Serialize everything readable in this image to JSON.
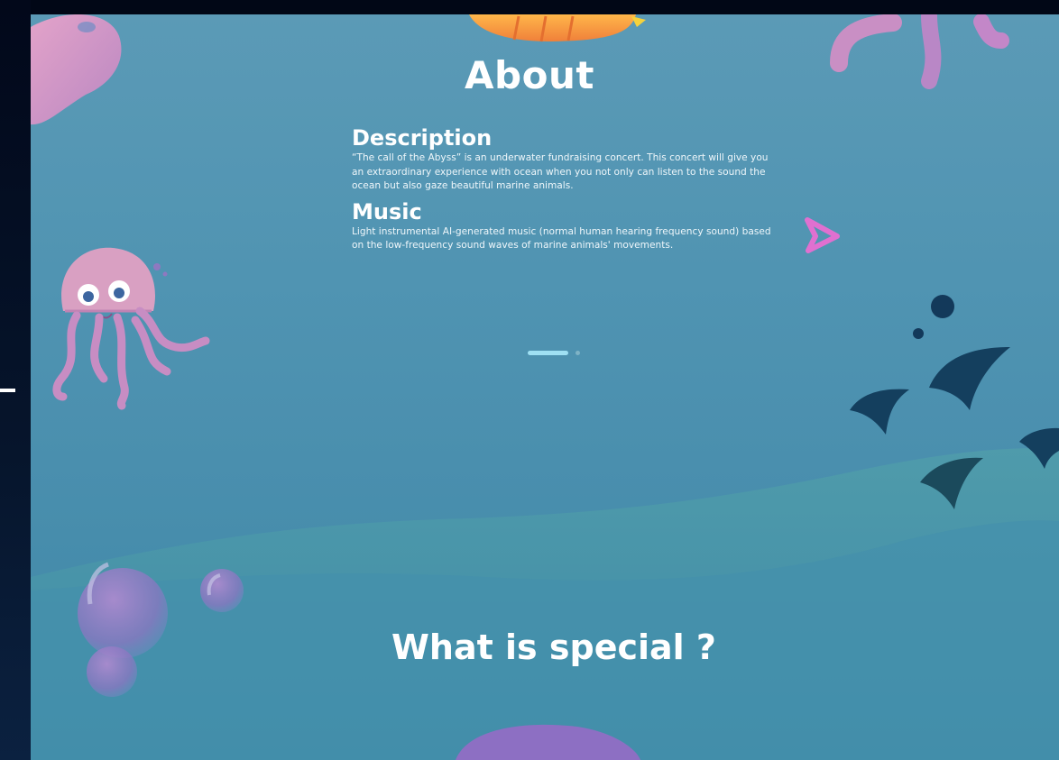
{
  "about": {
    "title": "About",
    "description_heading": "Description",
    "description_text": "“The call of the Abyss” is an underwater fundraising concert. This concert will give you an extraordinary experience with ocean when you not only can listen to the sound the ocean but also gaze beautiful marine animals.",
    "music_heading": "Music",
    "music_text": "Light instrumental AI-generated music (normal human hearing frequency sound) based on the low-frequency sound waves of marine animals' movements."
  },
  "carousel": {
    "total": 2,
    "active": 1
  },
  "special": {
    "title": "What is special ?"
  },
  "colors": {
    "frame": "#030b1a",
    "ocean": "#5094b2",
    "wave": "#4b98a5",
    "pink": "#d98fc0",
    "fish": "#15415d",
    "indicator": "#9fe0f3"
  },
  "icons": [
    "jellyfish-icon",
    "fish-icon",
    "bubble-icon",
    "tentacle-icon",
    "play-arrow-icon"
  ]
}
